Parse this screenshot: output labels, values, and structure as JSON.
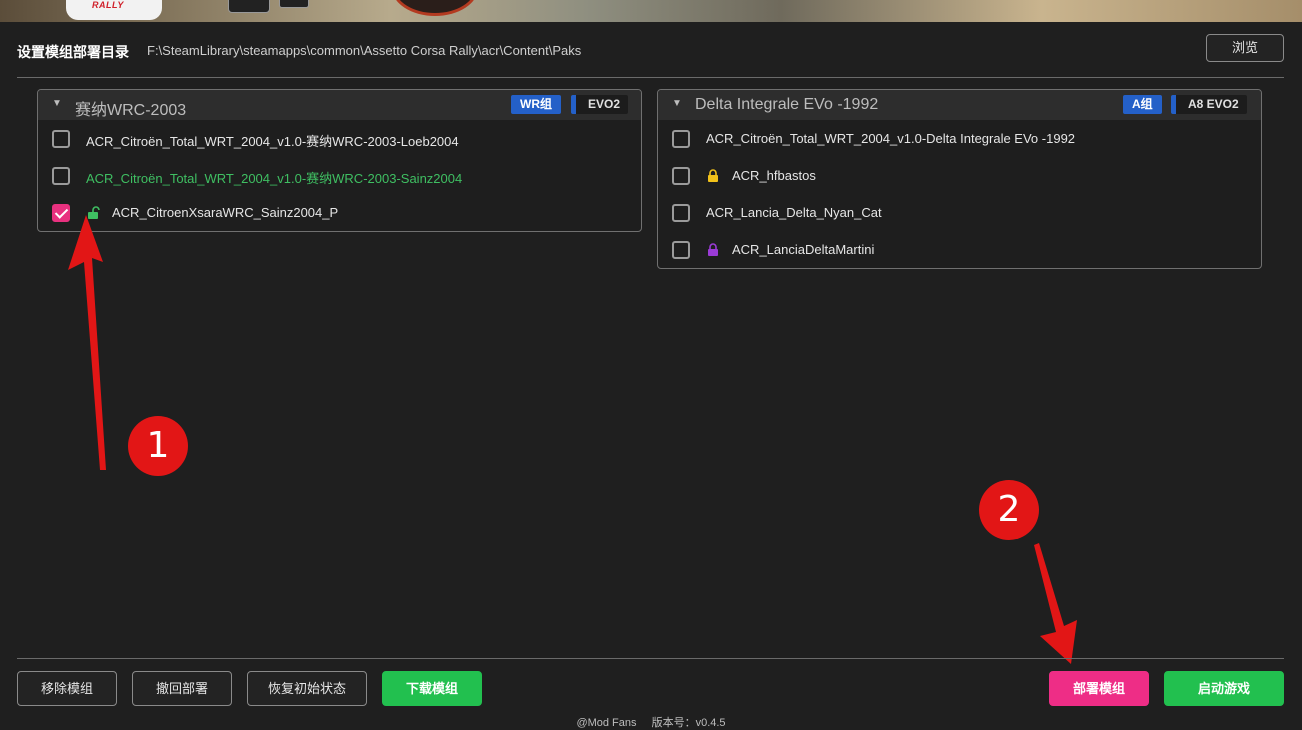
{
  "banner": {
    "logo_text": "RALLY"
  },
  "directory": {
    "label": "设置模组部署目录",
    "path": "F:\\SteamLibrary\\steamapps\\common\\Assetto Corsa Rally\\acr\\Content\\Paks",
    "browse_label": "浏览"
  },
  "panels": [
    {
      "title": "赛纳WRC-2003",
      "tag_group": "WR组",
      "tag_class": "EVO2",
      "items": [
        {
          "label": "ACR_Citroën_Total_WRT_2004_v1.0-赛纳WRC-2003-Loeb2004",
          "checked": false
        },
        {
          "label": "ACR_Citroën_Total_WRT_2004_v1.0-赛纳WRC-2003-Sainz2004",
          "checked": false,
          "highlight": "green"
        },
        {
          "label": "ACR_CitroenXsaraWRC_Sainz2004_P",
          "checked": true,
          "icon": "unlocked-lock-icon"
        }
      ]
    },
    {
      "title": "Delta Integrale EVo -1992",
      "tag_group": "A组",
      "tag_class": "A8 EVO2",
      "items": [
        {
          "label": "ACR_Citroën_Total_WRT_2004_v1.0-Delta Integrale EVo -1992",
          "checked": false
        },
        {
          "label": "ACR_hfbastos",
          "checked": false,
          "icon": "lock-icon",
          "icon_color": "#f2c21a"
        },
        {
          "label": "ACR_Lancia_Delta_Nyan_Cat",
          "checked": false
        },
        {
          "label": "ACR_LanciaDeltaMartini",
          "checked": false,
          "icon": "lock-icon",
          "icon_color": "#9b3bd6"
        }
      ]
    }
  ],
  "annotations": {
    "step1": "1",
    "step2": "2"
  },
  "actions": {
    "remove": "移除模组",
    "undeploy": "撤回部署",
    "restore": "恢复初始状态",
    "download": "下载模组",
    "deploy": "部署模组",
    "launch": "启动游戏"
  },
  "footer": {
    "author": "@Mod Fans",
    "version": "版本号：v0.4.5"
  },
  "colors": {
    "accent_pink": "#ee2d86",
    "accent_green": "#22c04f",
    "tag_blue": "#2460c8"
  }
}
